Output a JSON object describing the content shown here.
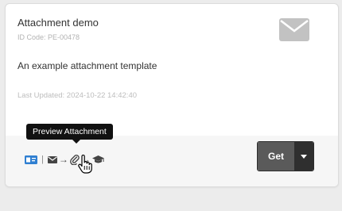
{
  "card": {
    "title": "Attachment demo",
    "id_code": "ID Code: PE-00478",
    "description": "An example attachment template",
    "last_updated": "Last Updated: 2024-10-22 14:42:40",
    "type_icon": "envelope-icon"
  },
  "flow": {
    "separator": "|",
    "steps": [
      "envelope-icon",
      "paperclip-icon",
      "graduation-cap-icon"
    ],
    "arrow": "→",
    "lead_icon": "id-card-icon"
  },
  "tooltip": {
    "text": "Preview Attachment"
  },
  "actions": {
    "get_label": "Get"
  },
  "colors": {
    "card_bg": "#ffffff",
    "footer_bg": "#f6f6f6",
    "accent_blue": "#2f7fd1",
    "button_dark": "#5a5a5a"
  }
}
